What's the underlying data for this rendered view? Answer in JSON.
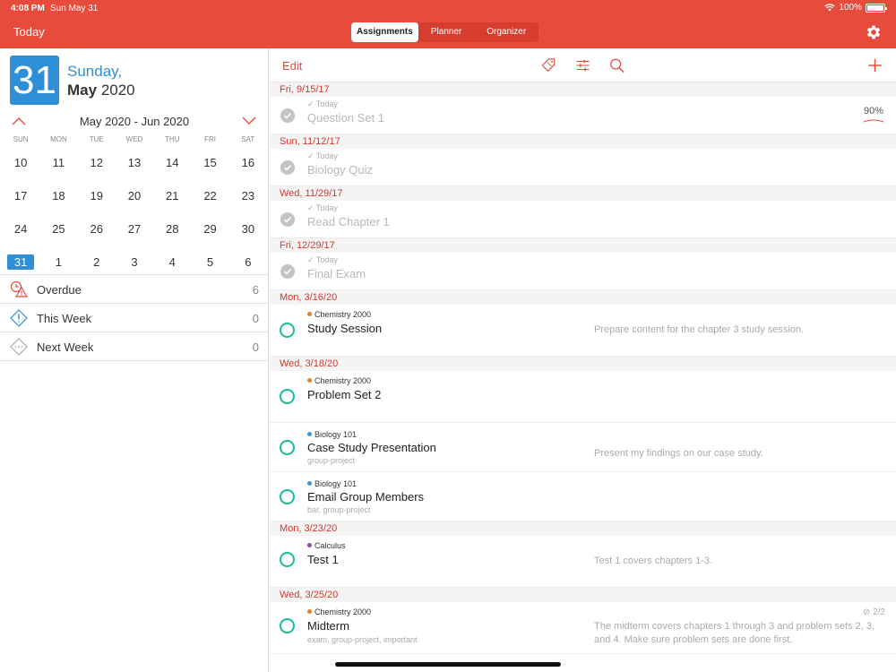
{
  "status_bar": {
    "time": "4:08 PM",
    "date": "Sun May 31",
    "battery": "100%",
    "battery_level": 1.0
  },
  "header": {
    "today_label": "Today",
    "tabs": [
      {
        "label": "Assignments",
        "active": true
      },
      {
        "label": "Planner",
        "active": false
      },
      {
        "label": "Organizer",
        "active": false
      }
    ],
    "settings_icon": "gear-icon"
  },
  "sidebar": {
    "date_tile": "31",
    "weekday": "Sunday,",
    "month": "May",
    "year": "2020",
    "range_label": "May 2020 - Jun 2020",
    "weekdays": [
      "SUN",
      "MON",
      "TUE",
      "WED",
      "THU",
      "FRI",
      "SAT"
    ],
    "weeks": [
      [
        "10",
        "11",
        "12",
        "13",
        "14",
        "15",
        "16"
      ],
      [
        "17",
        "18",
        "19",
        "20",
        "21",
        "22",
        "23"
      ],
      [
        "24",
        "25",
        "26",
        "27",
        "28",
        "29",
        "30"
      ],
      [
        "31",
        "1",
        "2",
        "3",
        "4",
        "5",
        "6"
      ]
    ],
    "today_day": "31",
    "filters": [
      {
        "label": "Overdue",
        "count": "6",
        "icon": "overdue-icon"
      },
      {
        "label": "This Week",
        "count": "0",
        "icon": "this-week-icon"
      },
      {
        "label": "Next Week",
        "count": "0",
        "icon": "next-week-icon"
      }
    ]
  },
  "toolbar": {
    "edit_label": "Edit",
    "icons": [
      "tag-icon",
      "filter-icon",
      "search-icon",
      "add-icon"
    ]
  },
  "colors": {
    "accent": "#e64b3c",
    "blue": "#2e8fd6",
    "teal": "#1abc9c",
    "chemistry": "#e67e22",
    "biology": "#3498db",
    "calculus": "#8e44ad"
  },
  "groups": [
    {
      "date": "Fri, 9/15/17",
      "tasks": [
        {
          "done": true,
          "meta": "✓ Today",
          "title": "Question Set 1",
          "grade": "90%"
        }
      ]
    },
    {
      "date": "Sun, 11/12/17",
      "tasks": [
        {
          "done": true,
          "meta": "✓ Today",
          "title": "Biology Quiz"
        }
      ]
    },
    {
      "date": "Wed, 11/29/17",
      "tasks": [
        {
          "done": true,
          "meta": "✓ Today",
          "title": "Read Chapter 1"
        }
      ]
    },
    {
      "date": "Fri, 12/29/17",
      "tasks": [
        {
          "done": true,
          "meta": "✓ Today",
          "title": "Final Exam"
        }
      ]
    },
    {
      "date": "Mon, 3/16/20",
      "tasks": [
        {
          "done": false,
          "course": "Chemistry 2000",
          "title": "Study Session",
          "desc": "Prepare content for the chapter 3 study session."
        }
      ]
    },
    {
      "date": "Wed, 3/18/20",
      "tasks": [
        {
          "done": false,
          "course": "Chemistry 2000",
          "title": "Problem Set 2"
        },
        {
          "done": false,
          "course": "Biology 101",
          "title": "Case Study Presentation",
          "tags": "group-project",
          "desc": "Present my findings on our case study."
        },
        {
          "done": false,
          "course": "Biology 101",
          "title": "Email Group Members",
          "tags": "bar, group-project"
        }
      ]
    },
    {
      "date": "Mon, 3/23/20",
      "tasks": [
        {
          "done": false,
          "course": "Calculus",
          "title": "Test 1",
          "desc": "Test 1 covers chapters 1-3."
        }
      ]
    },
    {
      "date": "Wed, 3/25/20",
      "tasks": [
        {
          "done": false,
          "course": "Chemistry 2000",
          "title": "Midterm",
          "tags": "exam, group-project, important",
          "desc": "The midterm covers chapters 1 through 3 and problem sets 2, 3, and 4. Make sure problem sets are done first.",
          "subtasks": "2/2"
        }
      ]
    }
  ]
}
